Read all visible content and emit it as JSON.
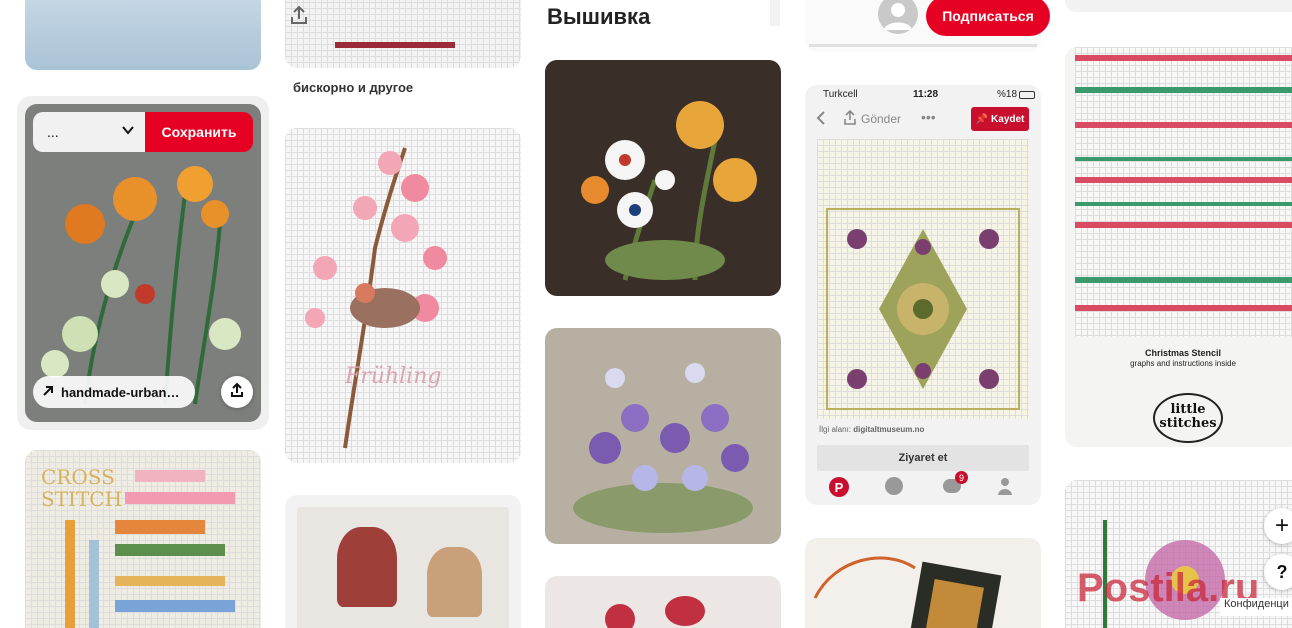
{
  "col3": {
    "title": "Вышивка"
  },
  "col2": {
    "caption": "бискорно и другое"
  },
  "pin_overlay": {
    "board_select": "...",
    "save_button": "Сохранить",
    "source_link": "handmade-urban…"
  },
  "header": {
    "follow_button": "Подписаться"
  },
  "phone": {
    "carrier": "Turkcell",
    "time": "11:28",
    "battery": "%18",
    "share_label": "Gönder",
    "save_label": "Kaydet",
    "source_prefix": "İlgi alanı:",
    "source_site": "digitaltmuseum.no",
    "visit_button": "Ziyaret et",
    "notif_count": "9"
  },
  "xmas": {
    "title": "Christmas Stencil",
    "subtitle": "graphs and instructions inside",
    "logo_line1": "little",
    "logo_line2": "stitches"
  },
  "watermark": "Postila.ru",
  "cookie_label": "Конфиденци",
  "colors": {
    "accent": "#e60023",
    "bg": "#ffffff"
  }
}
